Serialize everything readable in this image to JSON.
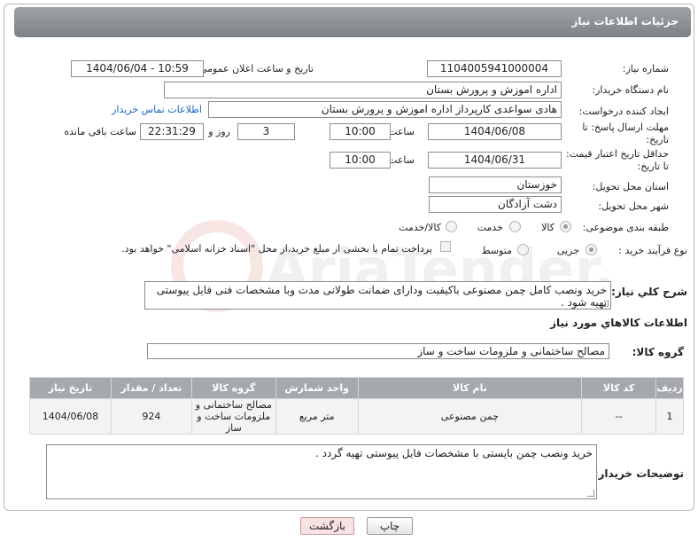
{
  "header": {
    "title": "جزئیات اطلاعات نیاز"
  },
  "fields": {
    "need_number": {
      "label": "شماره نیاز:",
      "value": "1104005941000004"
    },
    "announce": {
      "label": "تاریخ و ساعت اعلان عمومی:",
      "value": "1404/06/04 - 10:59"
    },
    "buyer_org": {
      "label": "نام دستگاه خریدار:",
      "value": "اداره اموزش و پرورش بستان"
    },
    "requester": {
      "label": "ایجاد کننده درخواست:",
      "value": "هادی سواعدی کارپرداز اداره اموزش و پرورش بستان",
      "contact_link": "اطلاعات تماس خریدار"
    },
    "deadline": {
      "label": "مهلت ارسال پاسخ: تا تاریخ:",
      "date": "1404/06/08",
      "time_label": "ساعت",
      "time": "10:00",
      "days": "3",
      "days_label": "روز و",
      "remaining": "22:31:29",
      "remaining_label": "ساعت باقی مانده"
    },
    "price_validity": {
      "label": "حداقل تاریخ اعتبار قیمت: تا تاریخ:",
      "date": "1404/06/31",
      "time_label": "ساعت",
      "time": "10:00"
    },
    "province": {
      "label": "استان محل تحویل:",
      "value": "خوزستان"
    },
    "city": {
      "label": "شهر محل تحویل:",
      "value": "دشت آزادگان"
    },
    "category": {
      "label": "طبقه بندی موضوعی:",
      "options": [
        "کالا",
        "خدمت",
        "کالا/خدمت"
      ]
    },
    "process": {
      "label": "نوع فرآیند خرید :",
      "options": [
        "جزیی",
        "متوسط"
      ],
      "payment_note": "پرداخت تمام یا بخشی از مبلغ خرید،از محل \"اسناد خزانه اسلامی\" خواهد بود."
    },
    "description": {
      "label": "شرح کلي نياز:",
      "value": "خرید ونصب کامل چمن مصنوعی باکیفیت ودارای ضمانت طولانی مدت وبا مشخصات فنی فایل پیوستی تهیه شود ."
    }
  },
  "goods": {
    "section_title": "اطلاعات کالاهاي مورد نياز",
    "group_label": "گروه کالا:",
    "group_value": "مصالح ساختمانی و ملزومات ساخت و ساز",
    "columns": [
      "ردیف",
      "کد کالا",
      "نام کالا",
      "واحد شمارش",
      "گروه کالا",
      "تعداد / مقدار",
      "تاریخ نیاز"
    ],
    "rows": [
      [
        "1",
        "--",
        "چمن مصنوعی",
        "متر مربع",
        "مصالح ساختمانی و ملزومات ساخت و ساز",
        "924",
        "1404/06/08"
      ]
    ]
  },
  "buyer_notes": {
    "label": "توضیحات خریدار:",
    "value": "خرید  ونصب  چمن بایستی  با  مشخصات فایل  پیوستی تهیه  گردد ."
  },
  "buttons": {
    "print": "چاپ",
    "back": "بازگشت"
  },
  "watermark": {
    "text": "AriaTender.net"
  }
}
